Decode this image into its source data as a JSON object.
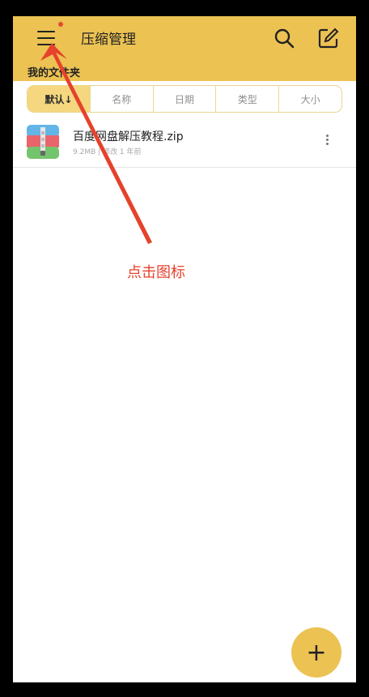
{
  "appbar": {
    "title": "压缩管理",
    "menu_icon": "hamburger-menu-icon",
    "search_icon": "search-icon",
    "edit_icon": "edit-icon",
    "background": "#ecc253"
  },
  "folder": {
    "title": "我的文件夹"
  },
  "sort": {
    "tabs": [
      {
        "label": "默认↓",
        "active": true
      },
      {
        "label": "名称",
        "active": false
      },
      {
        "label": "日期",
        "active": false
      },
      {
        "label": "类型",
        "active": false
      },
      {
        "label": "大小",
        "active": false
      }
    ]
  },
  "files": [
    {
      "name": "百度网盘解压教程.zip",
      "meta": "9.2MB | 修改 1 年前",
      "icon": "zip-archive-icon"
    }
  ],
  "annotation": {
    "text": "点击图标",
    "color": "#e5422c"
  },
  "fab": {
    "label": "+"
  }
}
